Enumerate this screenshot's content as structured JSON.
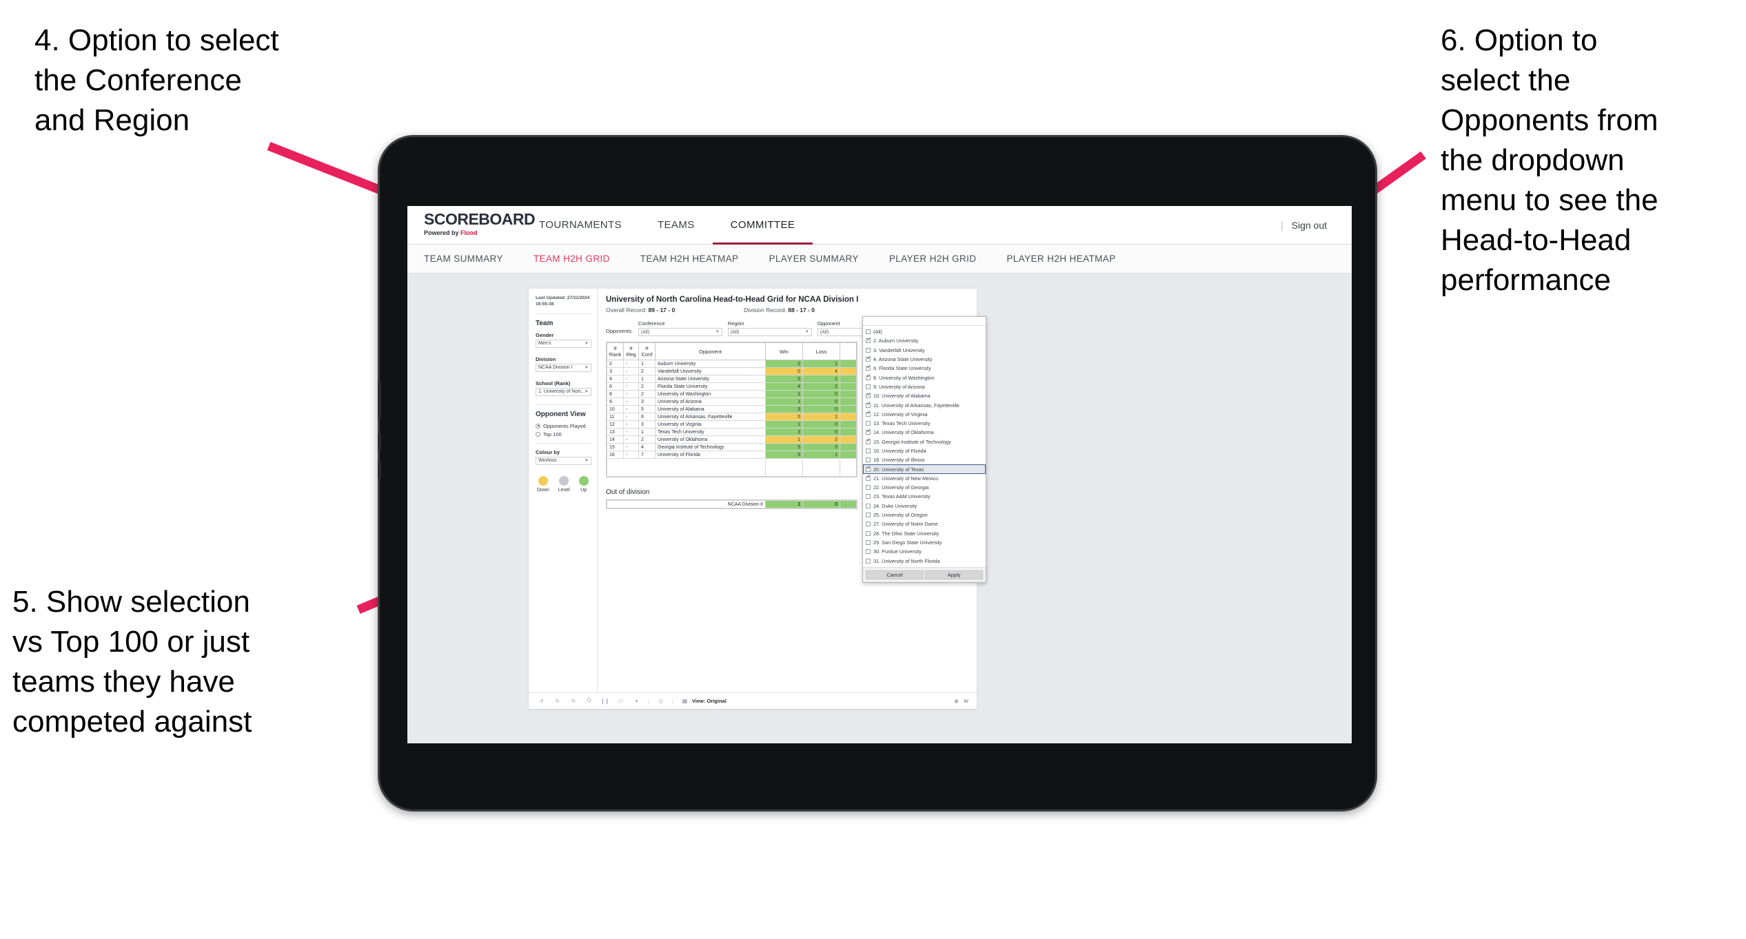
{
  "annotations": [
    {
      "id": "a4",
      "text": "4. Option to select\nthe Conference\nand Region"
    },
    {
      "id": "a5",
      "text": "5. Show selection\nvs Top 100 or just\nteams they have\ncompeted against"
    },
    {
      "id": "a6",
      "text": "6. Option to\nselect the\nOpponents from\nthe dropdown\nmenu to see the\nHead-to-Head\nperformance"
    }
  ],
  "colors": {
    "arrow": "#E8215C",
    "accent_red": "#E8385A",
    "brand_underline": "#9E1B3B",
    "green": "#8FCE72",
    "gold": "#F2CC56",
    "level_grey": "#C6C8CC"
  },
  "app_header": {
    "brand_title": "SCOREBOARD",
    "brand_sub_prefix": "Powered by",
    "brand_sub_accent": "Flood",
    "tabs": [
      {
        "label": "TOURNAMENTS",
        "active": false
      },
      {
        "label": "TEAMS",
        "active": false
      },
      {
        "label": "COMMITTEE",
        "active": true
      }
    ],
    "separator": "|",
    "sign_out": "Sign out"
  },
  "sub_nav": {
    "tabs": [
      {
        "label": "TEAM SUMMARY",
        "active": false
      },
      {
        "label": "TEAM H2H GRID",
        "active": true
      },
      {
        "label": "TEAM H2H HEATMAP",
        "active": false
      },
      {
        "label": "PLAYER SUMMARY",
        "active": false
      },
      {
        "label": "PLAYER H2H GRID",
        "active": false
      },
      {
        "label": "PLAYER H2H HEATMAP",
        "active": false
      }
    ]
  },
  "control_panel": {
    "last_updated_line1": "Last Updated: 27/11/2024",
    "last_updated_line2": "16:55:38",
    "team_heading": "Team",
    "gender_label": "Gender",
    "gender_value": "Men's",
    "division_label": "Division",
    "division_value": "NCAA Division I",
    "school_label": "School (Rank)",
    "school_value": "1. University of Nort...",
    "opponent_view_heading": "Opponent View",
    "opponent_view_options": [
      {
        "label": "Opponents Played",
        "selected": true
      },
      {
        "label": "Top 100",
        "selected": false
      }
    ],
    "colour_by_label": "Colour by",
    "colour_by_value": "Win/loss",
    "legend": [
      {
        "label": "Down",
        "color": "#F2CC56"
      },
      {
        "label": "Level",
        "color": "#C6C8CC"
      },
      {
        "label": "Up",
        "color": "#8FCE72"
      }
    ]
  },
  "viz": {
    "title": "University of North Carolina Head-to-Head Grid for NCAA Division I",
    "overall_record_label": "Overall Record:",
    "overall_record_value": "89 - 17 - 0",
    "division_record_label": "Division Record:",
    "division_record_value": "88 - 17 - 0",
    "opponents_label": "Opponents:",
    "filters": [
      {
        "label": "Conference",
        "value": "(All)"
      },
      {
        "label": "Region",
        "value": "(All)"
      },
      {
        "label": "Opponent",
        "value": "(All)"
      }
    ],
    "out_of_division_heading": "Out of division"
  },
  "chart_data": {
    "type": "table",
    "title": "University of North Carolina Head-to-Head Grid for NCAA Division I",
    "columns": [
      "# Rank",
      "# Reg",
      "# Conf",
      "Opponent",
      "Win",
      "Loss",
      ""
    ],
    "column_headers_split": [
      {
        "l1": "#",
        "l2": "Rank"
      },
      {
        "l1": "#",
        "l2": "Reg"
      },
      {
        "l1": "#",
        "l2": "Conf"
      },
      {
        "l1": "",
        "l2": "Opponent"
      },
      {
        "l1": "",
        "l2": "Win"
      },
      {
        "l1": "",
        "l2": "Loss"
      },
      {
        "l1": "",
        "l2": ""
      }
    ],
    "rows": [
      {
        "rank": "2",
        "reg": "-",
        "conf": "1",
        "opponent": "Auburn University",
        "win": "2",
        "loss": "1",
        "color": "green"
      },
      {
        "rank": "3",
        "reg": "-",
        "conf": "2",
        "opponent": "Vanderbilt University",
        "win": "0",
        "loss": "4",
        "color": "gold"
      },
      {
        "rank": "4",
        "reg": "-",
        "conf": "1",
        "opponent": "Arizona State University",
        "win": "5",
        "loss": "1",
        "color": "green"
      },
      {
        "rank": "6",
        "reg": "-",
        "conf": "2",
        "opponent": "Florida State University",
        "win": "4",
        "loss": "2",
        "color": "green"
      },
      {
        "rank": "8",
        "reg": "-",
        "conf": "2",
        "opponent": "University of Washington",
        "win": "1",
        "loss": "0",
        "color": "green"
      },
      {
        "rank": "9",
        "reg": "-",
        "conf": "3",
        "opponent": "University of Arizona",
        "win": "1",
        "loss": "0",
        "color": "green"
      },
      {
        "rank": "10",
        "reg": "-",
        "conf": "5",
        "opponent": "University of Alabama",
        "win": "3",
        "loss": "0",
        "color": "green"
      },
      {
        "rank": "11",
        "reg": "-",
        "conf": "6",
        "opponent": "University of Arkansas, Fayetteville",
        "win": "0",
        "loss": "1",
        "color": "gold"
      },
      {
        "rank": "12",
        "reg": "-",
        "conf": "3",
        "opponent": "University of Virginia",
        "win": "1",
        "loss": "0",
        "color": "green"
      },
      {
        "rank": "13",
        "reg": "-",
        "conf": "1",
        "opponent": "Texas Tech University",
        "win": "3",
        "loss": "0",
        "color": "green"
      },
      {
        "rank": "14",
        "reg": "-",
        "conf": "2",
        "opponent": "University of Oklahoma",
        "win": "1",
        "loss": "2",
        "color": "gold"
      },
      {
        "rank": "15",
        "reg": "-",
        "conf": "4",
        "opponent": "Georgia Institute of Technology",
        "win": "5",
        "loss": "0",
        "color": "green"
      },
      {
        "rank": "16",
        "reg": "-",
        "conf": "7",
        "opponent": "University of Florida",
        "win": "3",
        "loss": "1",
        "color": "green"
      }
    ],
    "out_of_division_rows": [
      {
        "name": "NCAA Division II",
        "win": "1",
        "loss": "0",
        "color": "green"
      }
    ]
  },
  "opponent_dropdown": {
    "search_value": "",
    "cancel_label": "Cancel",
    "apply_label": "Apply",
    "options": [
      {
        "label": "(All)",
        "checked": false,
        "highlighted": false
      },
      {
        "label": "2. Auburn University",
        "checked": true,
        "highlighted": false
      },
      {
        "label": "3. Vanderbilt University",
        "checked": false,
        "highlighted": false
      },
      {
        "label": "4. Arizona State University",
        "checked": true,
        "highlighted": false
      },
      {
        "label": "6. Florida State University",
        "checked": true,
        "highlighted": false
      },
      {
        "label": "8. University of Washington",
        "checked": true,
        "highlighted": false
      },
      {
        "label": "9. University of Arizona",
        "checked": false,
        "highlighted": false
      },
      {
        "label": "10. University of Alabama",
        "checked": true,
        "highlighted": false
      },
      {
        "label": "11. University of Arkansas, Fayetteville",
        "checked": true,
        "highlighted": false
      },
      {
        "label": "12. University of Virginia",
        "checked": true,
        "highlighted": false
      },
      {
        "label": "13. Texas Tech University",
        "checked": false,
        "highlighted": false
      },
      {
        "label": "14. University of Oklahoma",
        "checked": true,
        "highlighted": false
      },
      {
        "label": "15. Georgia Institute of Technology",
        "checked": true,
        "highlighted": false
      },
      {
        "label": "16. University of Florida",
        "checked": false,
        "highlighted": false
      },
      {
        "label": "18. University of Illinois",
        "checked": false,
        "highlighted": false
      },
      {
        "label": "20. University of Texas",
        "checked": true,
        "highlighted": true
      },
      {
        "label": "21. University of New Mexico",
        "checked": true,
        "highlighted": false
      },
      {
        "label": "22. University of Georgia",
        "checked": false,
        "highlighted": false
      },
      {
        "label": "23. Texas A&M University",
        "checked": false,
        "highlighted": false
      },
      {
        "label": "24. Duke University",
        "checked": false,
        "highlighted": false
      },
      {
        "label": "25. University of Oregon",
        "checked": false,
        "highlighted": false
      },
      {
        "label": "27. University of Notre Dame",
        "checked": false,
        "highlighted": false
      },
      {
        "label": "28. The Ohio State University",
        "checked": false,
        "highlighted": false
      },
      {
        "label": "29. San Diego State University",
        "checked": false,
        "highlighted": false
      },
      {
        "label": "30. Purdue University",
        "checked": false,
        "highlighted": false
      },
      {
        "label": "31. University of North Florida",
        "checked": false,
        "highlighted": false
      }
    ]
  },
  "viz_footer": {
    "icons": [
      "undo-icon",
      "redo-icon",
      "revert-icon",
      "refresh-data-icon",
      "pause-updates-icon",
      "share-icon",
      "dropdown-caret-icon",
      "performance-icon"
    ],
    "view_label": "View: Original",
    "watch_label": "W"
  }
}
